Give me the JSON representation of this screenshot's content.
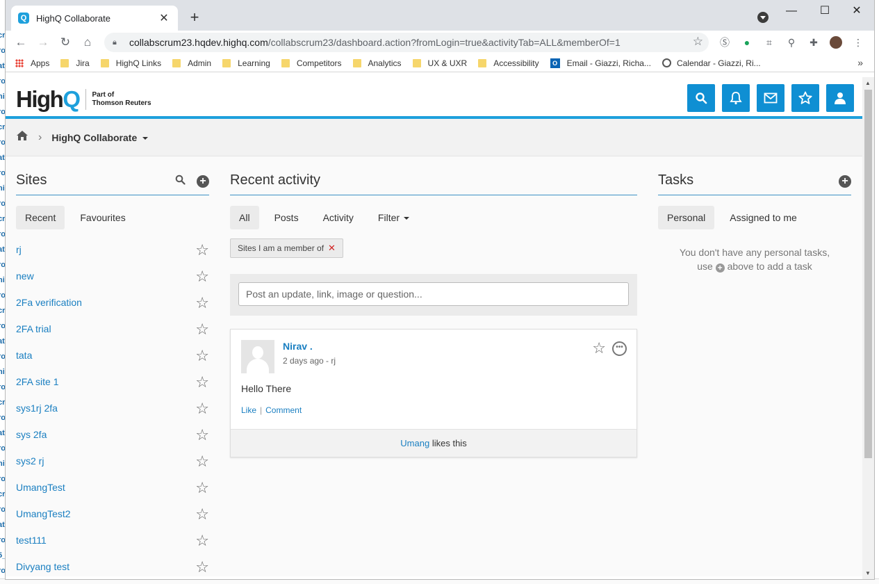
{
  "browser": {
    "tab_title": "HighQ Collaborate",
    "tab_favicon": "Q",
    "url_host": "collabscrum23.hqdev.highq.com",
    "url_path": "/collabscrum23/dashboard.action?fromLogin=true&activityTab=ALL&memberOf=1",
    "bookmarks": [
      "Apps",
      "Jira",
      "HighQ Links",
      "Admin",
      "Learning",
      "Competitors",
      "Analytics",
      "UX & UXR",
      "Accessibility",
      "Email - Giazzi, Richa...",
      "Calendar - Giazzi, Ri..."
    ],
    "colors": {
      "tabstrip": "#dee1e6",
      "folder": "#f6d66b"
    }
  },
  "header": {
    "logo_high": "High",
    "logo_q": "Q",
    "logo_sub_1": "Part of",
    "logo_sub_2": "Thomson Reuters",
    "icons": [
      "search-icon",
      "bell-icon",
      "envelope-icon",
      "star-icon",
      "user-icon"
    ],
    "accent": "#0f8fd3"
  },
  "breadcrumb": {
    "title": "HighQ Collaborate"
  },
  "sites": {
    "title": "Sites",
    "tabs": [
      "Recent",
      "Favourites"
    ],
    "items": [
      "rj",
      "new",
      "2Fa verification",
      "2FA trial",
      "tata",
      "2FA site 1",
      "sys1rj 2fa",
      "sys 2fa",
      "sys2 rj",
      "UmangTest",
      "UmangTest2",
      "test111",
      "Divyang test"
    ]
  },
  "activity": {
    "title": "Recent activity",
    "tabs": [
      "All",
      "Posts",
      "Activity",
      "Filter"
    ],
    "filter_chip": "Sites I am a member of",
    "post_placeholder": "Post an update, link, image or question...",
    "posts": [
      {
        "author": "Nirav .",
        "meta": "2 days ago - rj",
        "text": "Hello There",
        "like_label": "Like",
        "comment_label": "Comment",
        "liked_by": "Umang",
        "likes_suffix": "likes this"
      }
    ]
  },
  "tasks": {
    "title": "Tasks",
    "tabs": [
      "Personal",
      "Assigned to me"
    ],
    "empty_line1": "You don't have any personal tasks,",
    "empty_line2_pre": "use",
    "empty_line2_post": "above to add a task"
  },
  "background_window": {
    "fragments": [
      "cr",
      "ro",
      "at",
      "ro",
      "ni",
      "ro",
      "cr",
      "ro",
      "at",
      "ro",
      "ni",
      "ro",
      "cr",
      "ro",
      "at",
      "ro",
      "ni",
      "ro",
      "cr",
      "ro",
      "at",
      "ro",
      "ni",
      "ro",
      "cr",
      "ro",
      "at",
      "ro",
      "ni",
      "ro",
      "cr",
      "ro",
      "at",
      "ro",
      "5_",
      "ro"
    ]
  }
}
